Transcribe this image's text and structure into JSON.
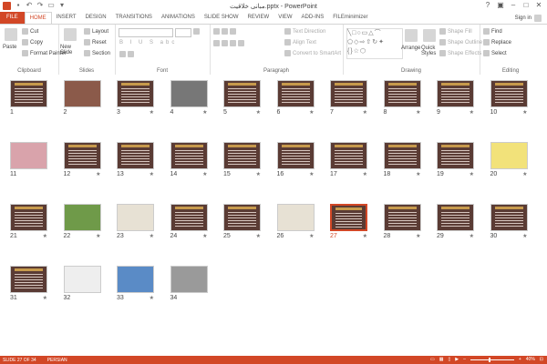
{
  "window": {
    "title": "مبانی خلاقیت.pptx - PowerPoint"
  },
  "qat_icons": [
    "save-icon",
    "undo-icon",
    "redo-icon",
    "present-icon",
    "customize-icon"
  ],
  "tabs": [
    "FILE",
    "HOME",
    "INSERT",
    "DESIGN",
    "TRANSITIONS",
    "ANIMATIONS",
    "SLIDE SHOW",
    "REVIEW",
    "VIEW",
    "ADD-INS",
    "FILEminimizer"
  ],
  "active_tab": "HOME",
  "account": {
    "sign_in": "Sign in"
  },
  "ribbon": {
    "clipboard": {
      "name": "Clipboard",
      "paste": "Paste",
      "cut": "Cut",
      "copy": "Copy",
      "format_painter": "Format Painter"
    },
    "slides": {
      "name": "Slides",
      "new_slide": "New Slide",
      "layout": "Layout",
      "reset": "Reset",
      "section": "Section"
    },
    "font": {
      "name": "Font"
    },
    "paragraph": {
      "name": "Paragraph",
      "text_direction": "Text Direction",
      "align_text": "Align Text",
      "convert_smartart": "Convert to SmartArt"
    },
    "drawing": {
      "name": "Drawing",
      "arrange": "Arrange",
      "quick_styles": "Quick Styles",
      "shape_fill": "Shape Fill",
      "shape_outline": "Shape Outline",
      "shape_effects": "Shape Effects"
    },
    "editing": {
      "name": "Editing",
      "find": "Find",
      "replace": "Replace",
      "select": "Select"
    }
  },
  "slides": [
    {
      "n": "1",
      "star": "",
      "style": "dark"
    },
    {
      "n": "2",
      "star": "",
      "style": "photo"
    },
    {
      "n": "3",
      "star": "★",
      "style": "dark"
    },
    {
      "n": "4",
      "star": "★",
      "style": "bw"
    },
    {
      "n": "5",
      "star": "★",
      "style": "dark"
    },
    {
      "n": "6",
      "star": "★",
      "style": "dark"
    },
    {
      "n": "7",
      "star": "★",
      "style": "dark"
    },
    {
      "n": "8",
      "star": "★",
      "style": "dark"
    },
    {
      "n": "9",
      "star": "★",
      "style": "dark"
    },
    {
      "n": "10",
      "star": "★",
      "style": "dark"
    },
    {
      "n": "11",
      "star": "",
      "style": "pink"
    },
    {
      "n": "12",
      "star": "★",
      "style": "dark"
    },
    {
      "n": "13",
      "star": "★",
      "style": "dark"
    },
    {
      "n": "14",
      "star": "★",
      "style": "dark"
    },
    {
      "n": "15",
      "star": "★",
      "style": "dark"
    },
    {
      "n": "16",
      "star": "★",
      "style": "dark"
    },
    {
      "n": "17",
      "star": "★",
      "style": "dark"
    },
    {
      "n": "18",
      "star": "★",
      "style": "dark"
    },
    {
      "n": "19",
      "star": "★",
      "style": "dark"
    },
    {
      "n": "20",
      "star": "★",
      "style": "yellow"
    },
    {
      "n": "21",
      "star": "★",
      "style": "dark"
    },
    {
      "n": "22",
      "star": "★",
      "style": "green"
    },
    {
      "n": "23",
      "star": "★",
      "style": "light"
    },
    {
      "n": "24",
      "star": "★",
      "style": "dark"
    },
    {
      "n": "25",
      "star": "★",
      "style": "dark"
    },
    {
      "n": "26",
      "star": "★",
      "style": "light"
    },
    {
      "n": "27",
      "star": "★",
      "style": "dark"
    },
    {
      "n": "28",
      "star": "★",
      "style": "dark"
    },
    {
      "n": "29",
      "star": "★",
      "style": "dark"
    },
    {
      "n": "30",
      "star": "★",
      "style": "dark"
    },
    {
      "n": "31",
      "star": "★",
      "style": "dark"
    },
    {
      "n": "32",
      "star": "",
      "style": "pyr"
    },
    {
      "n": "33",
      "star": "★",
      "style": "blue"
    },
    {
      "n": "34",
      "star": "",
      "style": "grayphoto"
    }
  ],
  "selected_slide": "27",
  "status": {
    "slide": "SLIDE 27 OF 34",
    "language": "PERSIAN",
    "zoom": "40%"
  },
  "colors": {
    "accent": "#d24726"
  }
}
